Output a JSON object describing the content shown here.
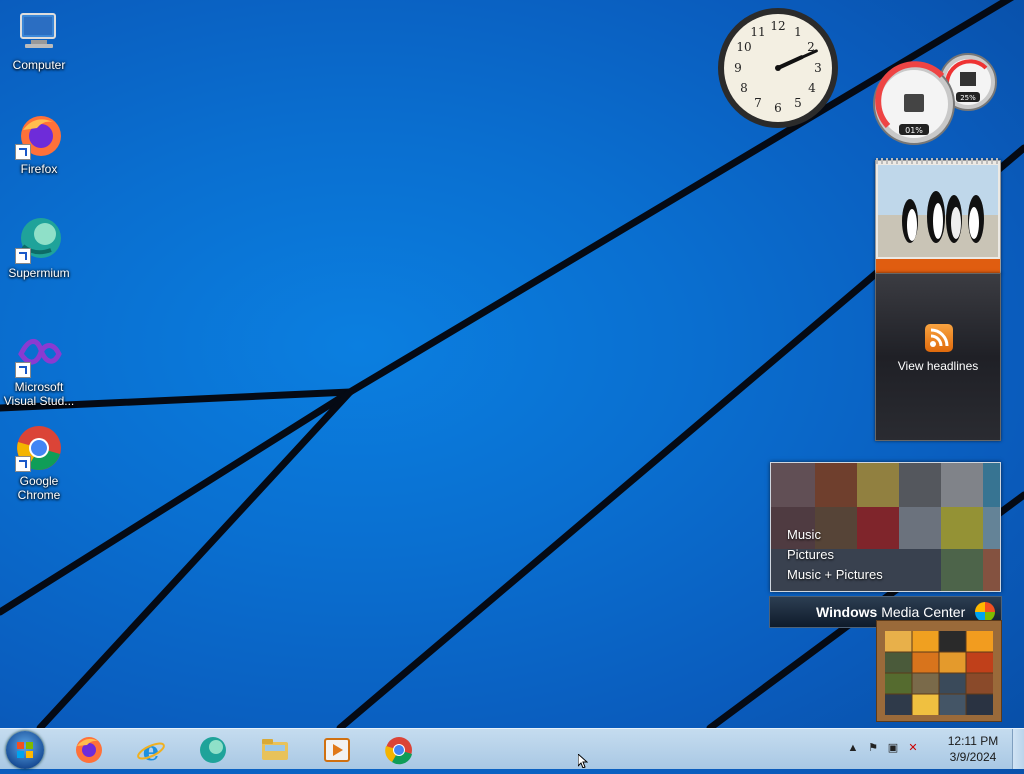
{
  "desktop": {
    "icons": [
      {
        "label_line1": "Computer",
        "label_line2": ""
      },
      {
        "label_line1": "Firefox",
        "label_line2": ""
      },
      {
        "label_line1": "Supermium",
        "label_line2": ""
      },
      {
        "label_line1": "Microsoft",
        "label_line2": "Visual Stud..."
      },
      {
        "label_line1": "Google",
        "label_line2": "Chrome"
      }
    ]
  },
  "gadgets": {
    "clock": {
      "hour": 2,
      "minute": 11
    },
    "cpu_meter": {
      "cpu_label": "01%",
      "memory_label": "25%"
    },
    "feed": {
      "text": "View headlines"
    },
    "media_center": {
      "menu": [
        "Music",
        "Pictures",
        "Music + Pictures"
      ],
      "brand_bold": "Windows",
      "brand_rest": " Media Center"
    }
  },
  "taskbar": {
    "pinned": [
      "start-button",
      "firefox",
      "internet-explorer",
      "supermium",
      "file-explorer",
      "media-player",
      "chrome"
    ],
    "clock_time": "12:11 PM",
    "clock_date": "3/9/2024"
  },
  "colors": {
    "accent": "#0a6fd0",
    "taskbar": "#b8d3ea"
  }
}
